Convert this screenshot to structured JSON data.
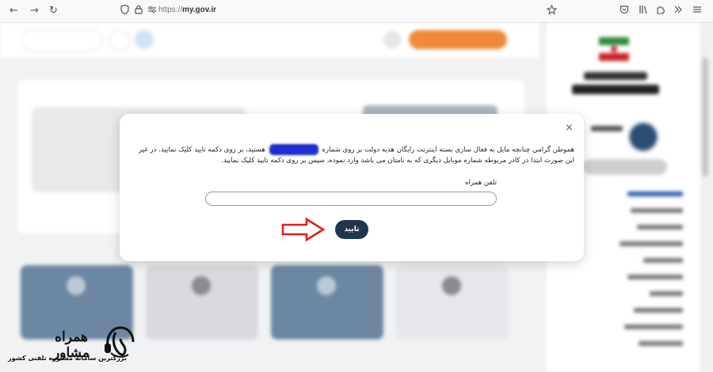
{
  "browser": {
    "nav_back": "←",
    "nav_forward": "→",
    "nav_reload": "↻",
    "url_prefix": "https://",
    "url_domain": "my.gov.ir"
  },
  "dialog": {
    "close_label": "×",
    "message_part1": "هموطن گرامی چنانچه مایل به فعال سازی بسته اینترنت رایگان هدیه دولت بر روی شماره",
    "message_part2": "هستید، بر روی دکمه تایید کلیک نمایید. در غیر این صورت ابتدا در کادر مربوطه شماره موبایل دیگری که به نامتان می باشد وارد نموده، سپس بر روی دکمه تایید کلیک نمایید.",
    "phone_label": "تلفن همراه",
    "phone_value": "",
    "confirm_label": "تایید"
  },
  "watermark": {
    "name": "همراه مشاور",
    "subtitle": "بزرگترین سامانه مشاوره تلفنی کشور"
  },
  "colors": {
    "confirm_button": "#1f3650",
    "annotation_arrow": "#e02020",
    "redaction": "#1d2fd0"
  }
}
